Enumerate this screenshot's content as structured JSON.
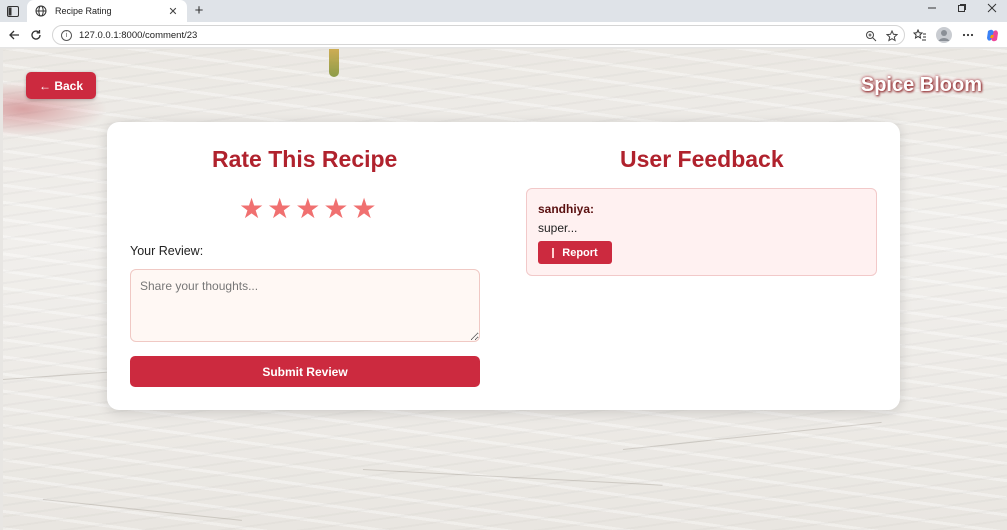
{
  "browser": {
    "tab_title": "Recipe Rating",
    "url": "127.0.0.1:8000/comment/23",
    "new_tab_glyph": "+",
    "tab_close_glyph": "✕",
    "icons": [
      "sidebar-icon",
      "globe-icon",
      "close-icon",
      "plus-icon",
      "minimize-icon",
      "restore-icon",
      "back-icon",
      "refresh-icon",
      "info-icon",
      "zoom-icon",
      "star-icon",
      "favorites-icon",
      "profile-icon",
      "more-icon",
      "copilot-icon"
    ]
  },
  "header": {
    "back_label": "← Back",
    "brand": "Spice Bloom"
  },
  "rating": {
    "title": "Rate This Recipe",
    "stars": [
      "★",
      "★",
      "★",
      "★",
      "★"
    ],
    "review_label": "Your Review:",
    "review_placeholder": "Share your thoughts...",
    "review_value": "",
    "submit_label": "Submit Review"
  },
  "feedback": {
    "title": "User Feedback",
    "items": [
      {
        "user": "sandhiya:",
        "text": "super...",
        "report_label": "Report"
      }
    ]
  },
  "colors": {
    "accent": "#cc2a3f",
    "title": "#b0222d",
    "star": "#f07070",
    "feedback_bg": "#fff1f1"
  }
}
